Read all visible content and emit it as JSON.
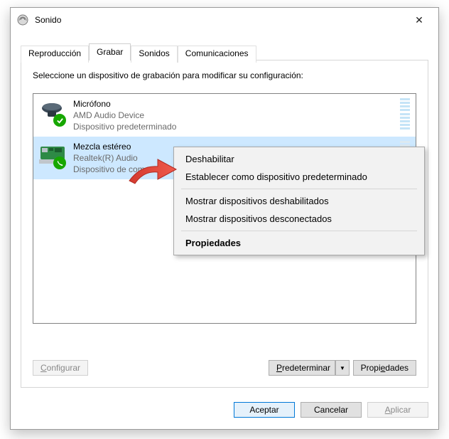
{
  "window": {
    "title": "Sonido",
    "close_glyph": "✕"
  },
  "tabs": [
    {
      "label": "Reproducción",
      "active": false
    },
    {
      "label": "Grabar",
      "active": true
    },
    {
      "label": "Sonidos",
      "active": false
    },
    {
      "label": "Comunicaciones",
      "active": false
    }
  ],
  "instruction": "Seleccione un dispositivo de grabación para modificar su configuración:",
  "devices": [
    {
      "name": "Micrófono",
      "driver": "AMD Audio Device",
      "status": "Dispositivo predeterminado",
      "badge": "check",
      "selected": false
    },
    {
      "name": "Mezcla estéreo",
      "driver": "Realtek(R) Audio",
      "status": "Dispositivo de com",
      "badge": "phone",
      "selected": true
    }
  ],
  "panel_buttons": {
    "configure": "Configurar",
    "configure_u": "C",
    "predet": "Predeterminar",
    "predet_u": "P",
    "predet_drop": "▼",
    "props": "Propiedades",
    "props_u": "e"
  },
  "dialog_buttons": {
    "ok": "Aceptar",
    "cancel": "Cancelar",
    "apply": "Aplicar",
    "apply_u": "A"
  },
  "context_menu": {
    "disable": "Deshabilitar",
    "set_default": "Establecer como dispositivo predeterminado",
    "show_disabled": "Mostrar dispositivos deshabilitados",
    "show_disconnected": "Mostrar dispositivos desconectados",
    "properties": "Propiedades"
  }
}
